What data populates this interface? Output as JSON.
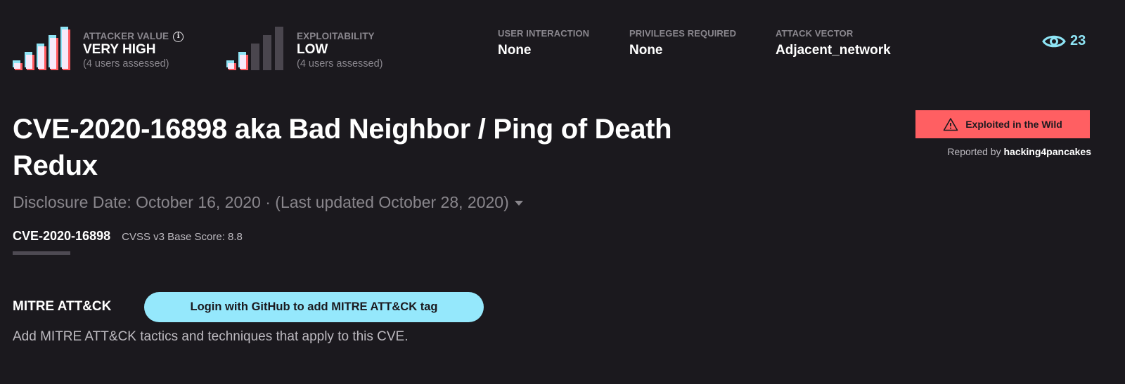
{
  "metrics": {
    "attacker_value": {
      "label": "ATTACKER VALUE",
      "value": "VERY HIGH",
      "assessed": "(4 users assessed)",
      "level": 5,
      "max_level": 5
    },
    "exploitability": {
      "label": "EXPLOITABILITY",
      "value": "LOW",
      "assessed": "(4 users assessed)",
      "level": 2,
      "max_level": 5
    }
  },
  "cvss_fields": [
    {
      "label": "USER INTERACTION",
      "value": "None"
    },
    {
      "label": "PRIVILEGES REQUIRED",
      "value": "None"
    },
    {
      "label": "ATTACK VECTOR",
      "value": "Adjacent_network"
    }
  ],
  "views": {
    "icon": "eye-icon",
    "count": "23"
  },
  "title": "CVE-2020-16898 aka Bad Neighbor / Ping of Death Redux",
  "exploited": {
    "icon": "warning-icon",
    "label": "Exploited in the Wild",
    "reported_prefix": "Reported by",
    "reported_by": "hacking4pancakes"
  },
  "dates": {
    "text": "Disclosure Date: October 16, 2020 · (Last updated October 28, 2020)"
  },
  "cve_tab": {
    "id": "CVE-2020-16898",
    "score": "CVSS v3 Base Score: 8.8"
  },
  "mitre": {
    "label": "MITRE ATT&CK",
    "button": "Login with GitHub to add MITRE ATT&CK tag",
    "description": "Add MITRE ATT&CK tactics and techniques that apply to this CVE."
  },
  "colors": {
    "background": "#1b191e",
    "accent_cyan": "#95e8fc",
    "alert_red": "#ff5f62"
  }
}
